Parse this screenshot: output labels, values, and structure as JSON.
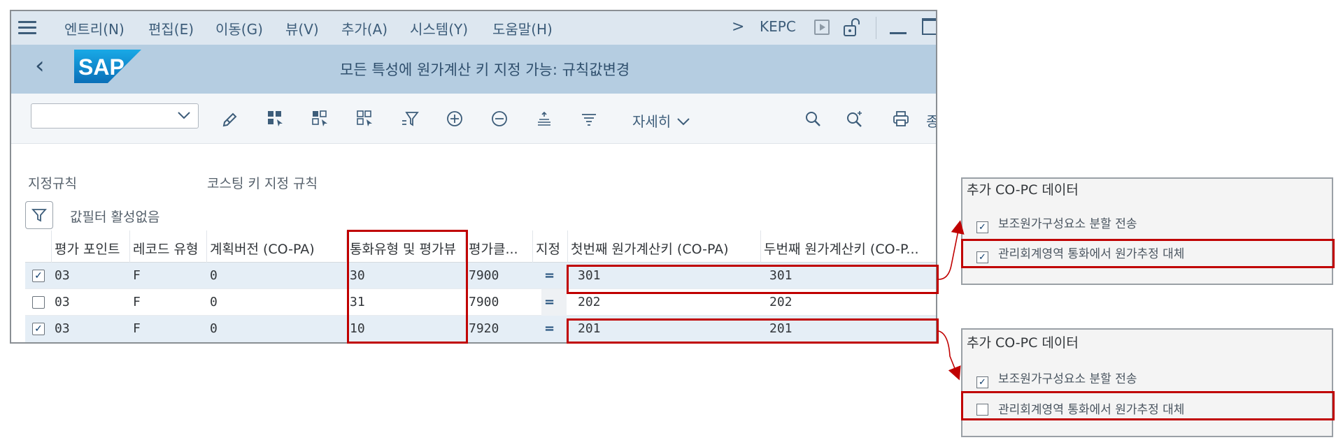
{
  "menu": {
    "items": [
      "엔트리(N)",
      "편집(E)",
      "이동(G)",
      "뷰(V)",
      "추가(A)",
      "시스템(Y)",
      "도움말(H)"
    ],
    "system_id": "KEPC"
  },
  "header": {
    "title": "모든 특성에 원가계산 키 지정 가능: 규칙값변경"
  },
  "toolbar": {
    "variant_value": "",
    "details_label": "자세히",
    "truncated_label": "종",
    "icons": [
      "edit-icon",
      "select-all-icon",
      "select-block-icon",
      "deselect-icon",
      "filter-icon",
      "add-icon",
      "remove-icon",
      "align-icon",
      "sort-icon",
      "search-icon",
      "search-next-icon",
      "print-icon"
    ]
  },
  "context": {
    "label": "지정규칙",
    "value": "코스팅 키 지정 규칙",
    "filter_text": "값필터 활성없음"
  },
  "table": {
    "columns": [
      "평가 포인트",
      "레코드 유형",
      "계획버전 (CO-PA)",
      "통화유형 및 평가뷰",
      "평가클...",
      "지정",
      "첫번째 원가계산키 (CO-PA)",
      "두번째 원가계산키 (CO-P..."
    ],
    "rows": [
      {
        "selected": true,
        "cells": [
          "03",
          "F",
          "0",
          "30",
          "7900",
          "=",
          "301",
          "301"
        ]
      },
      {
        "selected": false,
        "cells": [
          "03",
          "F",
          "0",
          "31",
          "7900",
          "=",
          "202",
          "202"
        ]
      },
      {
        "selected": true,
        "cells": [
          "03",
          "F",
          "0",
          "10",
          "7920",
          "=",
          "201",
          "201"
        ]
      }
    ]
  },
  "panels": [
    {
      "title": "추가 CO-PC 데이터",
      "options": [
        {
          "label": "보조원가구성요소 분할 전송",
          "checked": true
        },
        {
          "label": "관리회계영역 통화에서 원가추정 대체",
          "checked": true
        }
      ]
    },
    {
      "title": "추가 CO-PC 데이터",
      "options": [
        {
          "label": "보조원가구성요소 분할 전송",
          "checked": true
        },
        {
          "label": "관리회계영역 통화에서 원가추정 대체",
          "checked": false
        }
      ]
    }
  ],
  "colors": {
    "highlight": "#c00000",
    "menubar": "#dde7f0",
    "titlebar": "#b5cde1",
    "selected_row": "#e5eef6"
  }
}
